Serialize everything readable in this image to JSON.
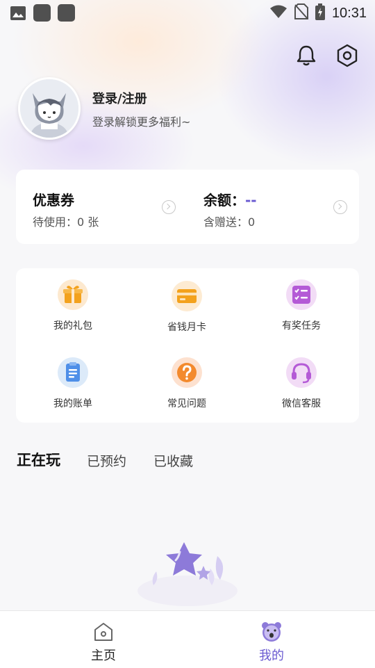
{
  "status_bar": {
    "time": "10:31"
  },
  "colors": {
    "accent": "#6a5ad1",
    "orange": "#f3a21d",
    "purple": "#b45ad6",
    "blue": "#4f8fe8"
  },
  "header": {
    "icons": [
      "bell-icon",
      "gear-icon"
    ]
  },
  "profile": {
    "title": "登录/注册",
    "subtitle": "登录解锁更多福利~"
  },
  "wallet": {
    "coupon": {
      "title": "优惠券",
      "sub": "待使用：0 张"
    },
    "balance": {
      "title": "余额：",
      "value": "--",
      "sub": "含赠送：0"
    }
  },
  "services": [
    {
      "label": "我的礼包",
      "icon": "gift-icon"
    },
    {
      "label": "省钱月卡",
      "icon": "card-icon"
    },
    {
      "label": "有奖任务",
      "icon": "task-list-icon"
    },
    {
      "label": "我的账单",
      "icon": "bill-icon"
    },
    {
      "label": "常见问题",
      "icon": "question-icon"
    },
    {
      "label": "微信客服",
      "icon": "headset-icon"
    }
  ],
  "tabs": [
    {
      "label": "正在玩",
      "active": true
    },
    {
      "label": "已预约",
      "active": false
    },
    {
      "label": "已收藏",
      "active": false
    }
  ],
  "bottom_nav": [
    {
      "label": "主页",
      "icon": "home-icon",
      "active": false
    },
    {
      "label": "我的",
      "icon": "bear-icon",
      "active": true
    }
  ]
}
